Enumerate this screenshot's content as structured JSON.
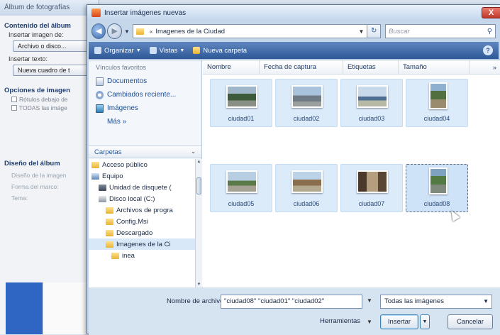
{
  "background_dialog": {
    "title": "Álbum de fotografías",
    "content_label": "Contenido del álbum",
    "insert_image_label": "Insertar imagen de:",
    "file_disk_button": "Archivo o disco...",
    "insert_text_label": "Insertar texto:",
    "new_text_box_button": "Nueva cuadro de t",
    "image_options_label": "Opciones de imagen",
    "option_captions": "Rótulos debajo de",
    "option_bw": "TODAS las imáge",
    "layout_label": "Diseño del álbum",
    "layout_item1": "Diseño de la imagen",
    "layout_item2": "Forma del marco:",
    "layout_item3": "Tema:"
  },
  "dialog": {
    "title": "Insertar imágenes nuevas",
    "close_label": "X",
    "address": {
      "folder": "Imagenes de la Ciudad",
      "separator": "«"
    },
    "search_placeholder": "Buscar",
    "toolbar": {
      "organize": "Organizar",
      "views": "Vistas",
      "new_folder": "Nueva carpeta",
      "help": "?"
    },
    "nav": {
      "favorites_heading": "Vínculos favoritos",
      "favorites": [
        "Documentos",
        "Cambiados reciente...",
        "Imágenes"
      ],
      "more": "Más »",
      "folders_heading": "Carpetas",
      "tree": [
        {
          "label": "Acceso público",
          "level": 0,
          "icon": "folder"
        },
        {
          "label": "Equipo",
          "level": 0,
          "icon": "pc"
        },
        {
          "label": "Unidad de disquete (",
          "level": 1,
          "icon": "floppy"
        },
        {
          "label": "Disco local (C:)",
          "level": 1,
          "icon": "drive"
        },
        {
          "label": "Archivos de progra",
          "level": 2,
          "icon": "folder"
        },
        {
          "label": "Config.Msi",
          "level": 2,
          "icon": "folder"
        },
        {
          "label": "Descargado",
          "level": 2,
          "icon": "folder"
        },
        {
          "label": "Imagenes de la Ci",
          "level": 2,
          "icon": "folder",
          "selected": true
        },
        {
          "label": "inea",
          "level": 3,
          "icon": "folder"
        }
      ]
    },
    "columns": [
      "Nombre",
      "Fecha de captura",
      "Etiquetas",
      "Tamaño"
    ],
    "columns_more": "»",
    "files": [
      {
        "name": "ciudad01",
        "photo": "p1"
      },
      {
        "name": "ciudad02",
        "photo": "p2"
      },
      {
        "name": "ciudad03",
        "photo": "p3"
      },
      {
        "name": "ciudad04",
        "photo": "p4",
        "tall": true
      },
      {
        "name": "ciudad05",
        "photo": "p5"
      },
      {
        "name": "ciudad06",
        "photo": "p6"
      },
      {
        "name": "ciudad07",
        "photo": "p7"
      },
      {
        "name": "ciudad08",
        "photo": "p8",
        "tall": true,
        "focused": true
      }
    ],
    "footer": {
      "filename_label": "Nombre de archivo:",
      "filename_value": "\"ciudad08\" \"ciudad01\" \"ciudad02\"",
      "filter_value": "Todas las imágenes",
      "tools_label": "Herramientas",
      "insert_button": "Insertar",
      "cancel_button": "Cancelar"
    }
  }
}
